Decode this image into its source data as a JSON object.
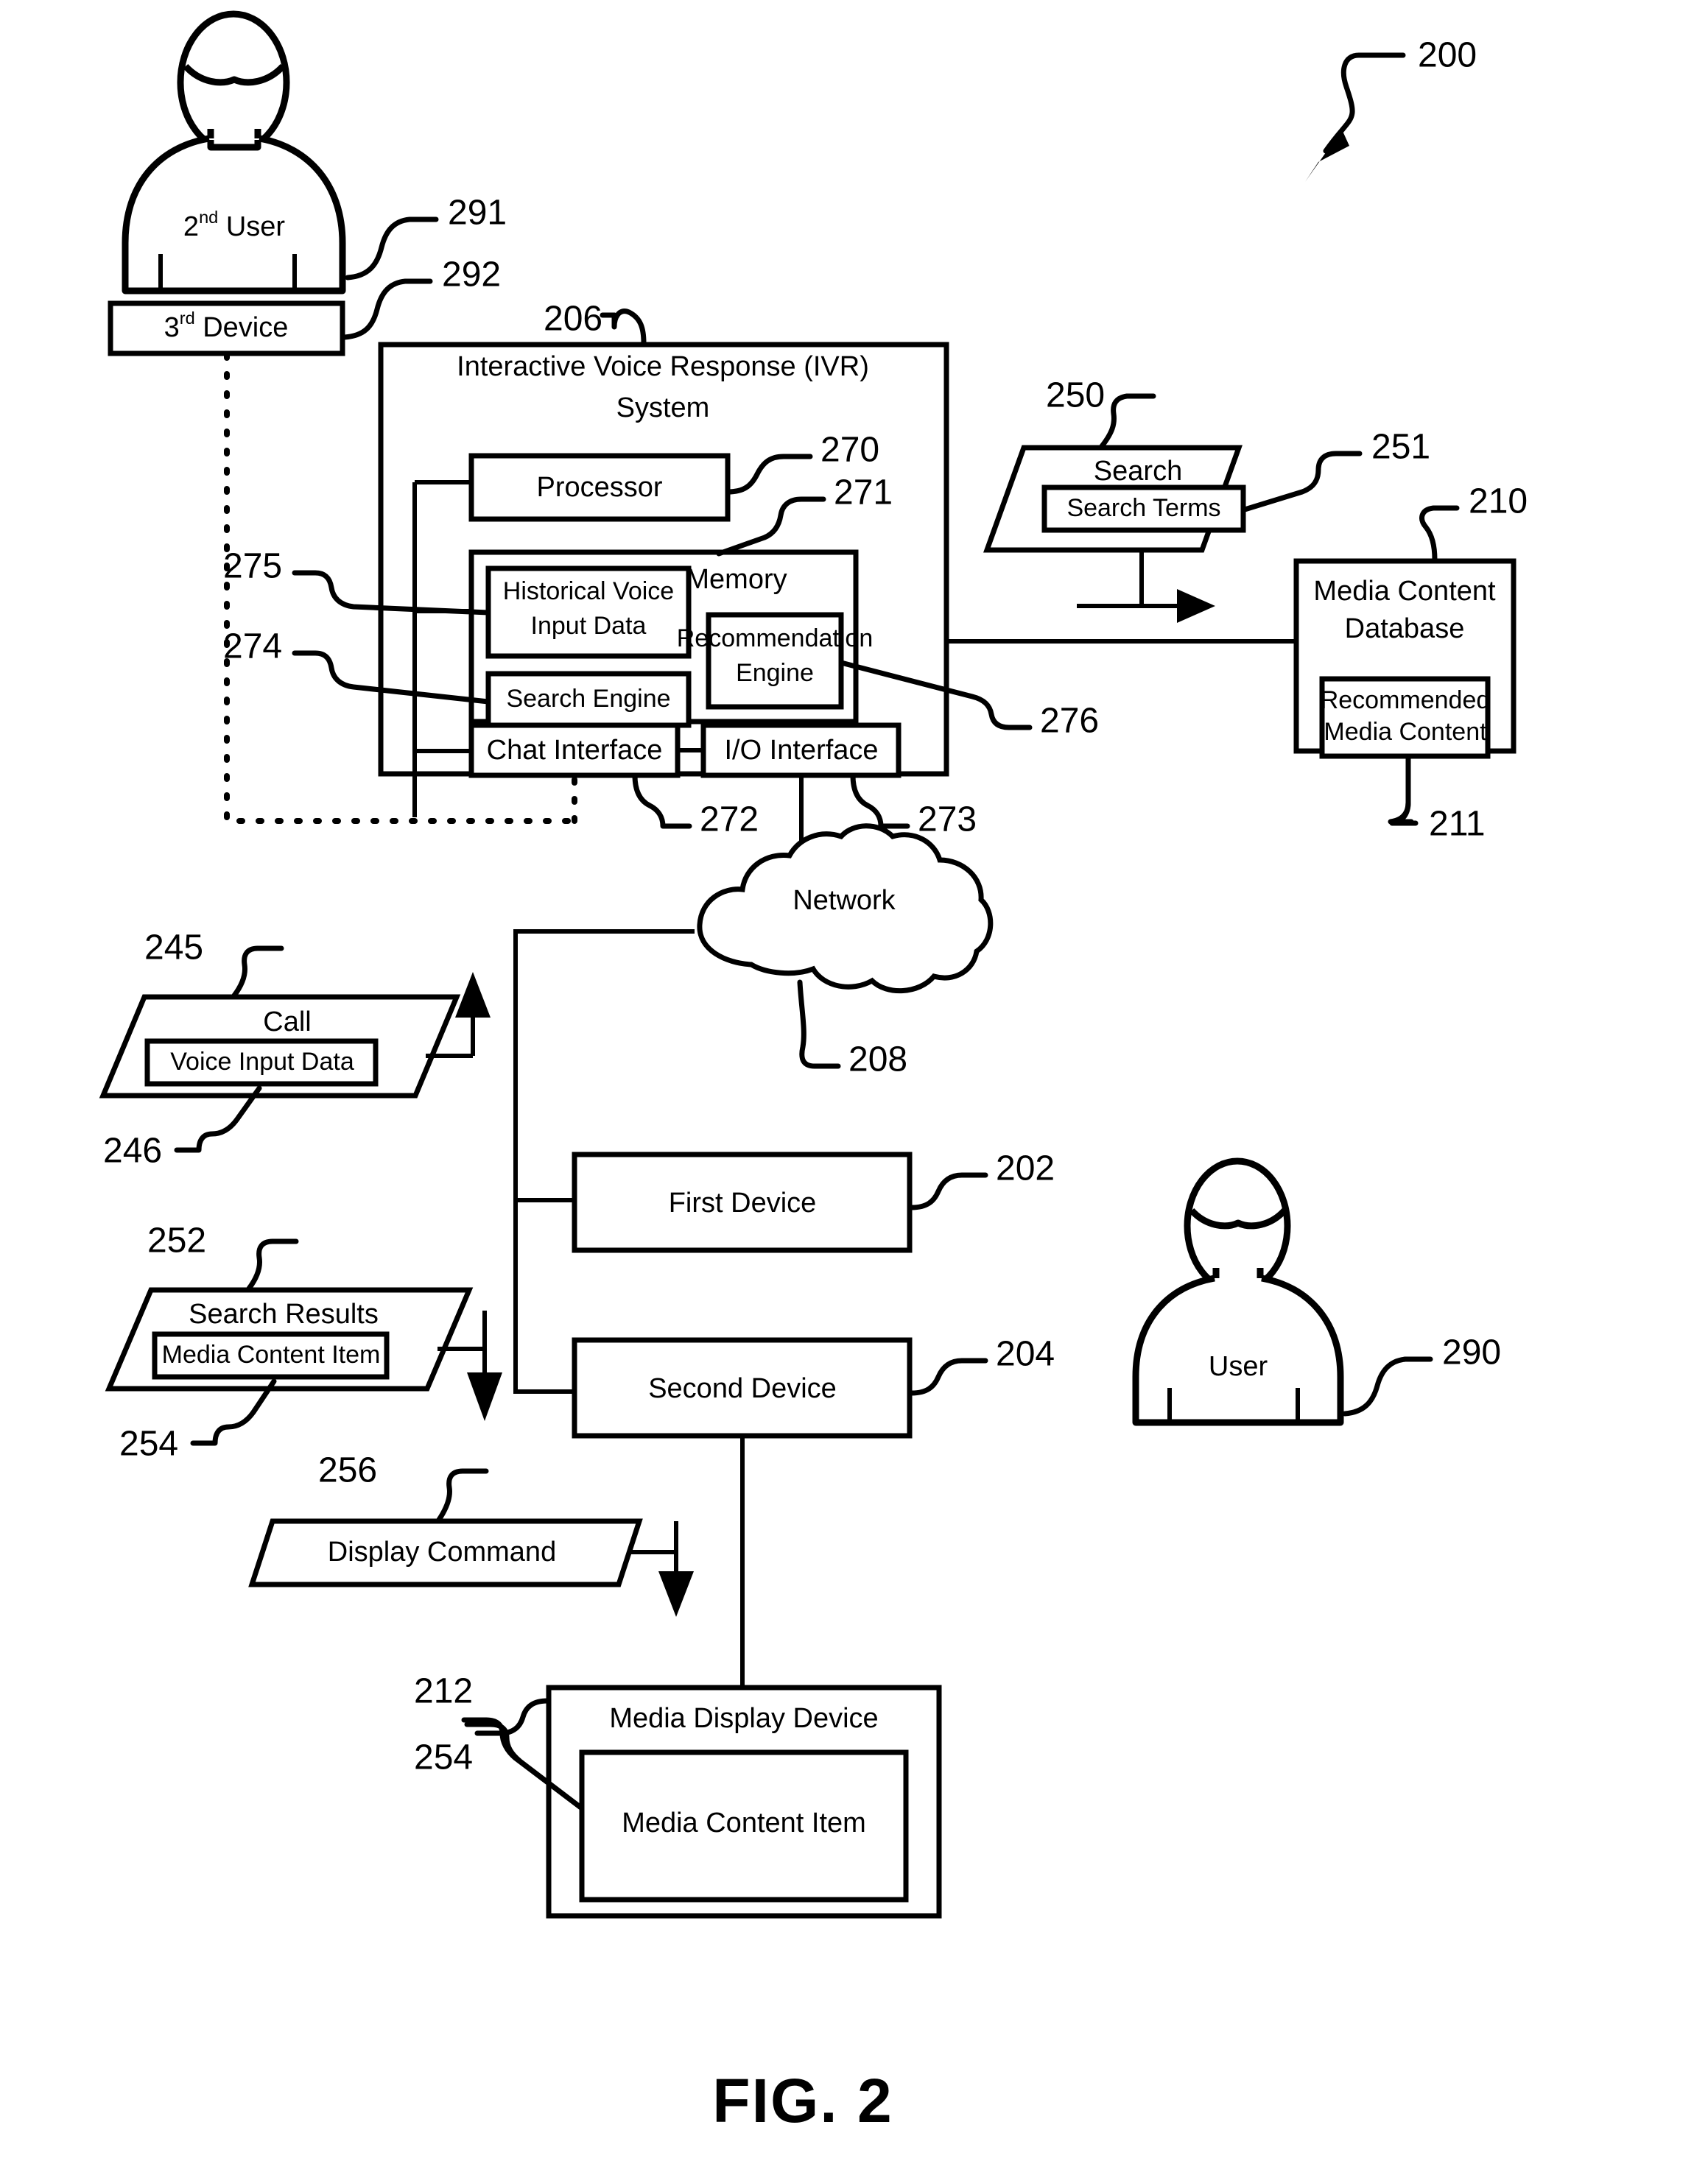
{
  "figure": {
    "caption": "FIG. 2",
    "system_ref": "200"
  },
  "actors": {
    "second_user": {
      "label_prefix": "2",
      "label_sup": "nd",
      "label_suffix": " User",
      "ref": "291"
    },
    "user": {
      "label": "User",
      "ref": "290"
    }
  },
  "nodes": {
    "third_device": {
      "label_prefix": "3",
      "label_sup": "rd",
      "label_suffix": " Device",
      "ref": "292"
    },
    "ivr_system": {
      "line1": "Interactive Voice Response (IVR)",
      "line2": "System",
      "ref": "206"
    },
    "processor": {
      "label": "Processor",
      "ref": "270"
    },
    "memory": {
      "label": "Memory",
      "ref": "271"
    },
    "historical_voice_input_data": {
      "line1": "Historical Voice",
      "line2": "Input Data",
      "ref": "275"
    },
    "search_engine": {
      "label": "Search Engine",
      "ref": "274"
    },
    "recommendation_engine": {
      "line1": "Recommendation",
      "line2": "Engine",
      "ref": "276"
    },
    "chat_interface": {
      "label": "Chat Interface",
      "ref": "272"
    },
    "io_interface": {
      "label": "I/O Interface",
      "ref": "273"
    },
    "search": {
      "label": "Search",
      "ref": "250"
    },
    "search_terms": {
      "label": "Search Terms",
      "ref": "251"
    },
    "media_content_database": {
      "line1": "Media Content",
      "line2": "Database",
      "ref": "210"
    },
    "recommended_media_content": {
      "line1": "Recommended",
      "line2": "Media Content",
      "ref": "211"
    },
    "network": {
      "label": "Network",
      "ref": "208"
    },
    "call": {
      "label": "Call",
      "ref": "245"
    },
    "voice_input_data": {
      "label": "Voice Input Data",
      "ref": "246"
    },
    "first_device": {
      "label": "First Device",
      "ref": "202"
    },
    "second_device": {
      "label": "Second Device",
      "ref": "204"
    },
    "search_results": {
      "label": "Search Results",
      "ref": "252"
    },
    "media_content_item_result": {
      "label": "Media Content Item",
      "ref": "254"
    },
    "display_command": {
      "label": "Display Command",
      "ref": "256"
    },
    "media_display_device": {
      "label": "Media Display Device",
      "ref": "212"
    },
    "media_content_item_display": {
      "label": "Media Content Item",
      "ref": "254"
    }
  },
  "colors": {
    "ink": "#000000",
    "paper": "#ffffff"
  }
}
